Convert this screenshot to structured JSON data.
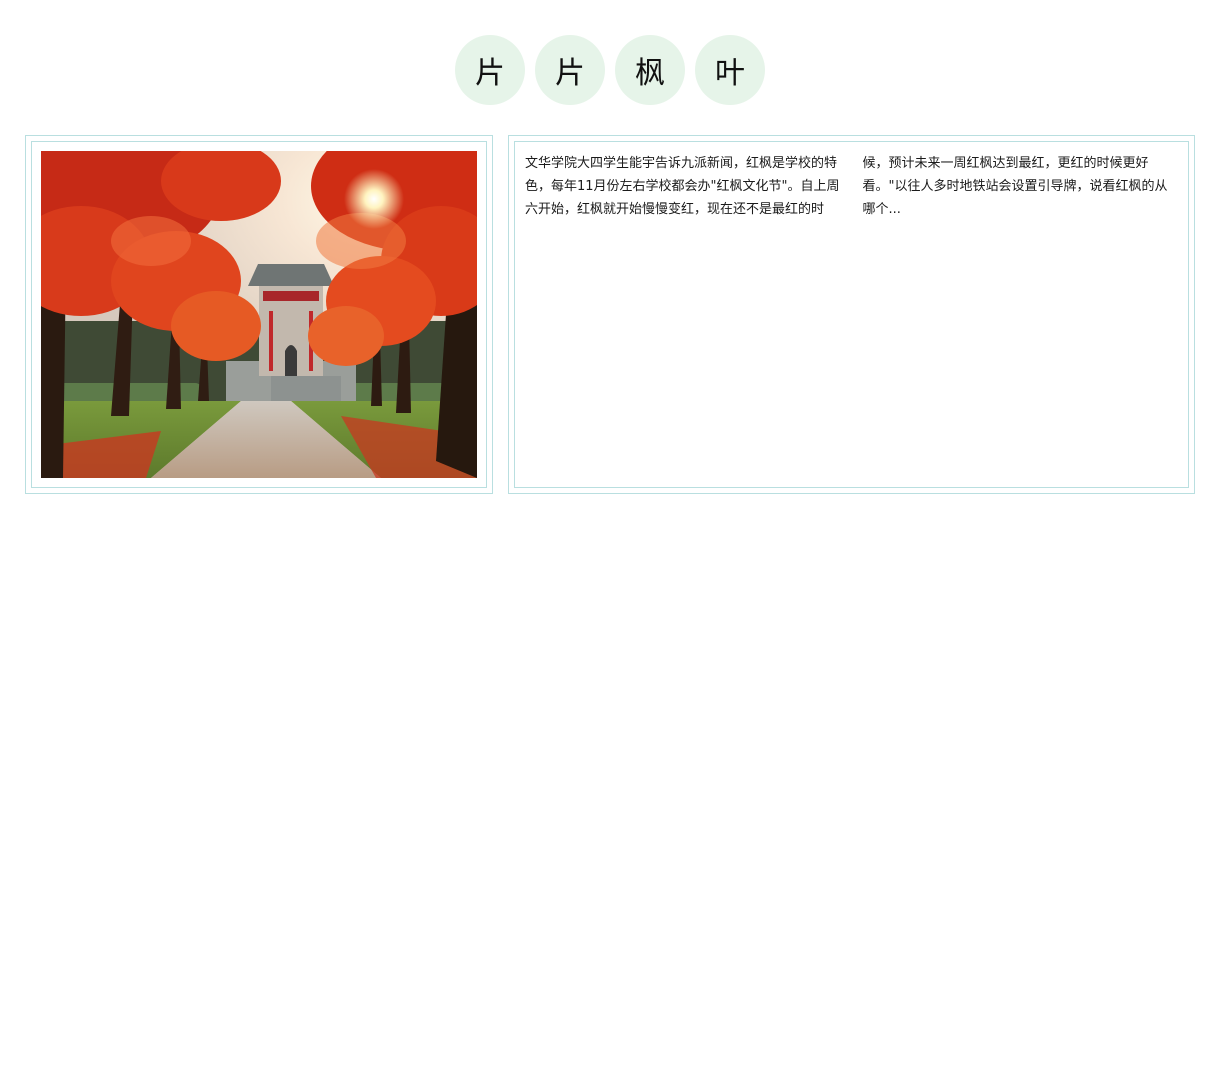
{
  "title": {
    "chars": [
      "片",
      "片",
      "枫",
      "叶"
    ]
  },
  "article": {
    "text": "文华学院大四学生能宇告诉九派新闻，红枫是学校的特色，每年11月份左右学校都会办\"红枫文化节\"。自上周六开始，红枫就开始慢慢变红，现在还不是最红的时候，预计未来一周红枫达到最红，更红的时候更好看。\"以往人多时地铁站会设置引导牌，说看红枫的从哪个..."
  },
  "colors": {
    "circle_bg": "#e6f4e9",
    "panel_border": "#b9dfe0",
    "maple_red": "#e0341c"
  }
}
